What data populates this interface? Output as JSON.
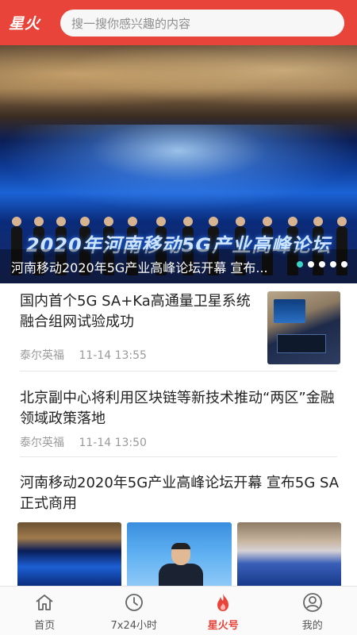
{
  "header": {
    "logo_text": "星火",
    "search_placeholder": "搜一搜你感兴趣的内容",
    "accent_color": "#e8443a"
  },
  "banner": {
    "stage_text": "2020年河南移动5G产业高峰论坛",
    "caption": "河南移动2020年5G产业高峰论坛开幕 宣布...",
    "dots_total": 5,
    "dots_active_index": 0
  },
  "articles": [
    {
      "title": "国内首个5G SA+Ka高通量卫星系统融合组网试验成功",
      "source": "泰尔英福",
      "time": "11-14 13:55",
      "thumbnail": "satellite-system-photo"
    },
    {
      "title": "北京副中心将利用区块链等新技术推动“两区”金融领域政策落地",
      "source": "泰尔英福",
      "time": "11-14 13:50"
    },
    {
      "title": "河南移动2020年5G产业高峰论坛开幕 宣布5G SA正式商用",
      "images": [
        "forum-stage-photo",
        "speaker-photo",
        "conference-hall-photo"
      ]
    }
  ],
  "bottom_nav": [
    {
      "label": "首页",
      "icon": "home-icon",
      "active": false
    },
    {
      "label": "7x24小时",
      "icon": "clock-icon",
      "active": false
    },
    {
      "label": "星火号",
      "icon": "flame-icon",
      "active": true
    },
    {
      "label": "我的",
      "icon": "profile-icon",
      "active": false
    }
  ]
}
